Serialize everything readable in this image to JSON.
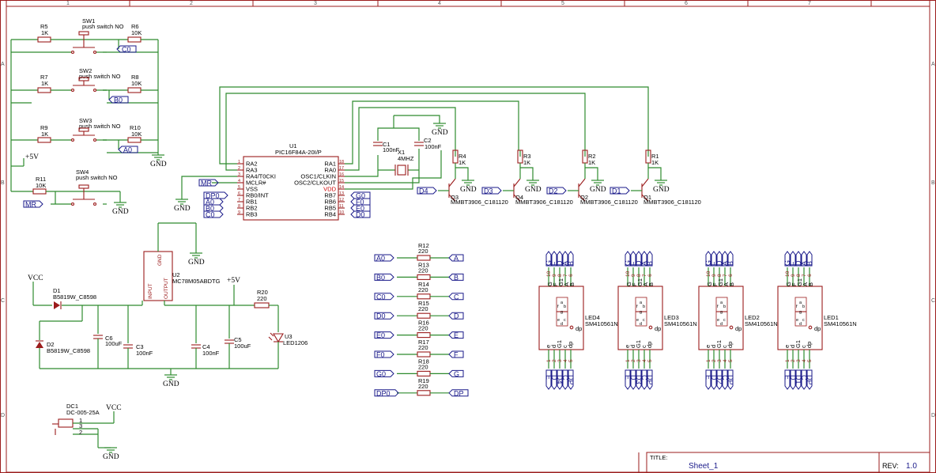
{
  "frame": {
    "cols": [
      "1",
      "2",
      "3",
      "4",
      "5",
      "6",
      "7"
    ],
    "rows": [
      "A",
      "B",
      "C",
      "D"
    ]
  },
  "title_block": {
    "title_label": "TITLE:",
    "title": "Sheet_1",
    "rev_label": "REV:",
    "rev": "1.0"
  },
  "power": {
    "gnd": "GND",
    "vcc": "VCC",
    "p5v": "+5V"
  },
  "nets": {
    "MR": "MR",
    "A0": "A0",
    "B0": "B0",
    "C0": "C0",
    "D0": "D0",
    "E0": "E0",
    "F0": "F0",
    "G0": "G0",
    "DP0": "DP0",
    "D1": "D1",
    "D2": "D2",
    "D3": "D3",
    "D4": "D4",
    "A": "A",
    "B": "B",
    "C": "C",
    "D": "D",
    "E": "E",
    "F": "F",
    "G": "G",
    "DP": "DP"
  },
  "switches": [
    {
      "ref": "SW1",
      "value": "push switch NO",
      "r_series": "R5",
      "r_series_val": "1K",
      "r_pull": "R6",
      "r_pull_val": "10K"
    },
    {
      "ref": "SW2",
      "value": "push switch NO",
      "r_series": "R7",
      "r_series_val": "1K",
      "r_pull": "R8",
      "r_pull_val": "10K"
    },
    {
      "ref": "SW3",
      "value": "push switch NO",
      "r_series": "R9",
      "r_series_val": "1K",
      "r_pull": "R10",
      "r_pull_val": "10K"
    },
    {
      "ref": "SW4",
      "value": "push switch NO",
      "r_series": "R11",
      "r_series_val": "10K"
    }
  ],
  "mcu": {
    "ref": "U1",
    "value": "PIC16F84A-20I/P",
    "left_pins": [
      {
        "num": "1",
        "name": "RA2"
      },
      {
        "num": "2",
        "name": "RA3"
      },
      {
        "num": "3",
        "name": "RA4/T0CKI"
      },
      {
        "num": "4",
        "name": "MCLR#"
      },
      {
        "num": "5",
        "name": "VSS"
      },
      {
        "num": "6",
        "name": "RB0/INT"
      },
      {
        "num": "7",
        "name": "RB1"
      },
      {
        "num": "8",
        "name": "RB2"
      },
      {
        "num": "9",
        "name": "RB3"
      }
    ],
    "right_pins": [
      {
        "num": "18",
        "name": "RA1"
      },
      {
        "num": "17",
        "name": "RA0"
      },
      {
        "num": "16",
        "name": "OSC1/CLKIN"
      },
      {
        "num": "15",
        "name": "OSC2/CLKOUT"
      },
      {
        "num": "14",
        "name": "VDD"
      },
      {
        "num": "13",
        "name": "RB7"
      },
      {
        "num": "12",
        "name": "RB6"
      },
      {
        "num": "11",
        "name": "RB5"
      },
      {
        "num": "10",
        "name": "RB4"
      }
    ]
  },
  "osc": {
    "c1_ref": "C1",
    "c1_val": "100nF",
    "c2_ref": "C2",
    "c2_val": "100nF",
    "x_ref": "X1",
    "x_val": "4MHZ"
  },
  "transistors": [
    {
      "ref": "Q3",
      "value": "MMBT3906_C181120",
      "r": "R4",
      "r_val": "1K",
      "base": "D4"
    },
    {
      "ref": "Q4",
      "value": "MMBT3906_C181120",
      "r": "R3",
      "r_val": "1K",
      "base": "D3"
    },
    {
      "ref": "Q2",
      "value": "MMBT3906_C181120",
      "r": "R2",
      "r_val": "1K",
      "base": "D2"
    },
    {
      "ref": "Q1",
      "value": "MMBT3906_C181120",
      "r": "R1",
      "r_val": "1K",
      "base": "D1"
    }
  ],
  "psu": {
    "d1_ref": "D1",
    "d1_val": "B5819W_C8598",
    "d2_ref": "D2",
    "d2_val": "B5819W_C8598",
    "u2_ref": "U2",
    "u2_val": "MC78M05ABDTG",
    "u2_in": "INPUT",
    "u2_out": "OUTPUT",
    "u2_gnd": "GND",
    "caps": [
      {
        "ref": "C6",
        "val": "100uF"
      },
      {
        "ref": "C3",
        "val": "100nF"
      },
      {
        "ref": "C4",
        "val": "100nF"
      },
      {
        "ref": "C5",
        "val": "100uF"
      }
    ],
    "r20_ref": "R20",
    "r20_val": "220",
    "u3_ref": "U3",
    "u3_val": "LED1206"
  },
  "dc": {
    "ref": "DC1",
    "value": "DC-005-25A",
    "pins": [
      "1",
      "3",
      "2"
    ]
  },
  "seg_resistors": [
    {
      "ref": "R12",
      "val": "220",
      "in": "A0",
      "out": "A"
    },
    {
      "ref": "R13",
      "val": "220",
      "in": "B0",
      "out": "B"
    },
    {
      "ref": "R14",
      "val": "220",
      "in": "C0",
      "out": "C"
    },
    {
      "ref": "R15",
      "val": "220",
      "in": "D0",
      "out": "D"
    },
    {
      "ref": "R16",
      "val": "220",
      "in": "E0",
      "out": "E"
    },
    {
      "ref": "R17",
      "val": "220",
      "in": "F0",
      "out": "F"
    },
    {
      "ref": "R18",
      "val": "220",
      "in": "G0",
      "out": "G"
    },
    {
      "ref": "R19",
      "val": "220",
      "in": "DP0",
      "out": "DP"
    }
  ],
  "displays": [
    {
      "ref": "LED4",
      "value": "SM410561N",
      "bottom_common": "D4"
    },
    {
      "ref": "LED3",
      "value": "SM410561N",
      "bottom_common": "D3"
    },
    {
      "ref": "LED2",
      "value": "SM410561N",
      "bottom_common": "D2"
    },
    {
      "ref": "LED1",
      "value": "SM410561N",
      "bottom_common": "D1"
    }
  ],
  "display_pins": {
    "top_names": [
      "G",
      "F",
      "G1",
      "A",
      "B"
    ],
    "top_nums": [
      "10",
      "9",
      "8",
      "7",
      "6"
    ],
    "bottom_names": [
      "e",
      "d",
      "G1",
      "c",
      "dp"
    ],
    "bottom_nums": [
      "1",
      "2",
      "3",
      "4",
      "5"
    ],
    "top_nets": [
      "G",
      "F",
      "D",
      "A",
      "B"
    ],
    "bottom_nets": [
      "E",
      "D",
      "C",
      "DP"
    ],
    "seg_letters": [
      "a",
      "f",
      "b",
      "g",
      "e",
      "c",
      "d"
    ],
    "dp_mark": "dp"
  }
}
